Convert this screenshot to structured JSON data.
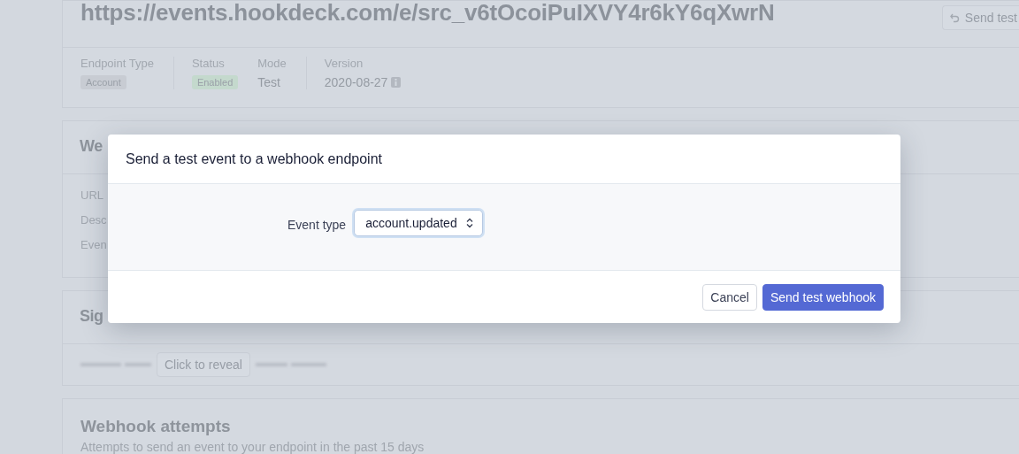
{
  "page": {
    "endpoint_url": "https://events.hookdeck.com/e/src_v6tOcoiPuIXVY4r6kY6qXwrN",
    "send_test_button": "Send test",
    "details": [
      {
        "label": "Endpoint Type",
        "value": "Account",
        "kind": "tag",
        "color": "#c8ccd3",
        "separated": false
      },
      {
        "label": "Status",
        "value": "Enabled",
        "kind": "tag",
        "color": "#c4d9cd",
        "separated": true
      },
      {
        "label": "Mode",
        "value": "Test",
        "kind": "text",
        "separated": false
      },
      {
        "label": "Version",
        "value": "2020-08-27",
        "kind": "info",
        "separated": true
      }
    ],
    "details_section": {
      "title": "We",
      "fields": [
        "URL",
        "Desc",
        "Even"
      ]
    },
    "signing_section": {
      "title": "Sig",
      "reveal_button": "Click to reveal"
    },
    "attempts_section": {
      "title": "Webhook attempts",
      "subtitle": "Attempts to send an event to your endpoint in the past 15 days"
    }
  },
  "modal": {
    "title": "Send a test event to a webhook endpoint",
    "field_label": "Event type",
    "event_type": "account.updated",
    "buttons": [
      {
        "label": "Cancel",
        "kind": "secondary"
      },
      {
        "label": "Send test webhook",
        "kind": "primary"
      }
    ]
  }
}
